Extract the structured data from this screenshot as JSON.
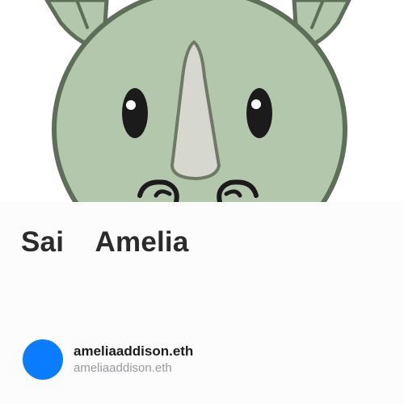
{
  "hero": {
    "image_icon": "rhino-face-illustration"
  },
  "profile": {
    "display_name": "Sai    Amelia"
  },
  "owner": {
    "avatar_color": "#0a7cff",
    "primary_name": "ameliaaddison.eth",
    "secondary_name": "ameliaaddison.eth"
  }
}
